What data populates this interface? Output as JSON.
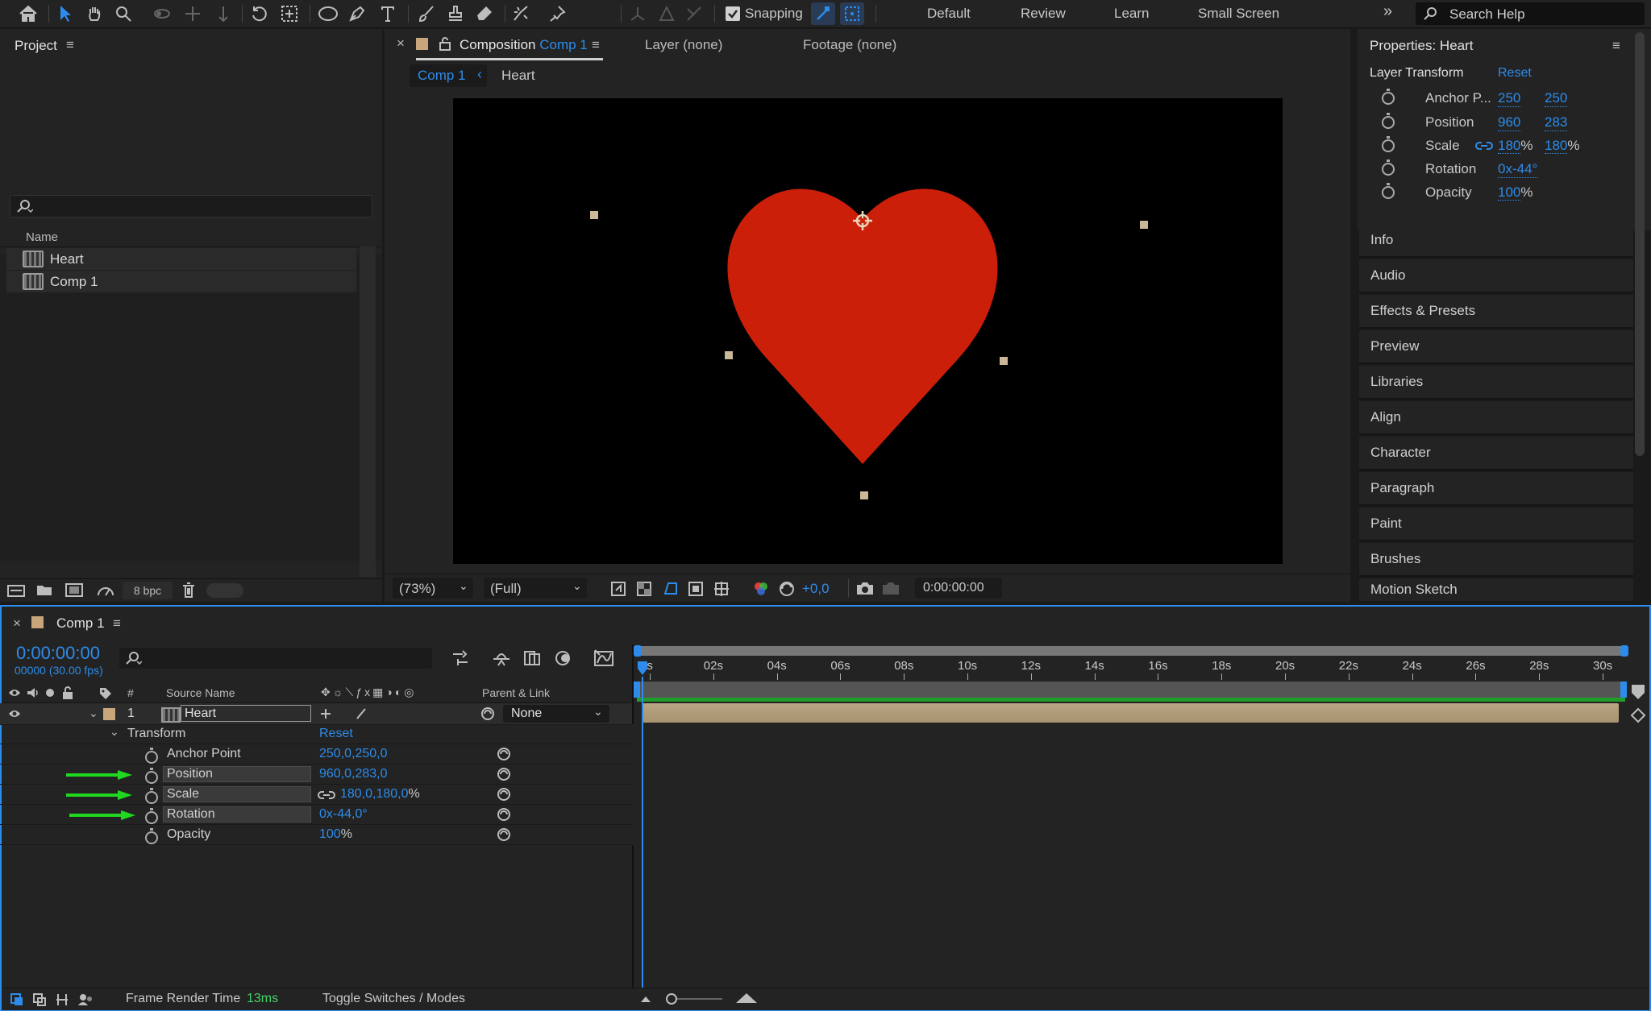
{
  "toolbar": {
    "snapping_label": "Snapping",
    "workspaces": [
      "Default",
      "Review",
      "Learn",
      "Small Screen"
    ],
    "search_placeholder": "Search Help"
  },
  "project": {
    "title": "Project",
    "column_name": "Name",
    "items": [
      {
        "label": "Heart"
      },
      {
        "label": "Comp 1"
      }
    ],
    "bit_depth": "8 bpc"
  },
  "composition": {
    "tab_prefix": "Composition",
    "tab_comp": "Comp 1",
    "layer_tab": "Layer (none)",
    "footage_tab": "Footage (none)",
    "breadcrumb_comp": "Comp 1",
    "breadcrumb_layer": "Heart",
    "zoom": "(73%)",
    "resolution": "(Full)",
    "exposure": "+0,0",
    "timecode": "0:00:00:00",
    "heart_color": "#cc1f0a"
  },
  "properties": {
    "title": "Properties: Heart",
    "section": "Layer Transform",
    "reset": "Reset",
    "rows": [
      {
        "label": "Anchor P...",
        "v1": "250",
        "v2": "250"
      },
      {
        "label": "Position",
        "v1": "960",
        "v2": "283"
      },
      {
        "label": "Scale",
        "v1": "180",
        "v2": "180"
      },
      {
        "label": "Rotation",
        "v1": "0x-44°"
      },
      {
        "label": "Opacity",
        "v1": "100"
      }
    ],
    "panels": [
      "Info",
      "Audio",
      "Effects & Presets",
      "Preview",
      "Libraries",
      "Align",
      "Character",
      "Paragraph",
      "Paint",
      "Brushes",
      "Motion Sketch"
    ]
  },
  "timeline": {
    "comp_name": "Comp 1",
    "timecode": "0:00:00:00",
    "fps": "00000 (30.00 fps)",
    "col_source_name": "Source Name",
    "col_parent": "Parent & Link",
    "col_number": "#",
    "layer_number": "1",
    "layer_name": "Heart",
    "parent_value": "None",
    "transform_label": "Transform",
    "transform_reset": "Reset",
    "props": [
      {
        "label": "Anchor Point",
        "value": "250,0,250,0"
      },
      {
        "label": "Position",
        "value": "960,0,283,0"
      },
      {
        "label": "Scale",
        "value": "180,0,180,0"
      },
      {
        "label": "Rotation",
        "value": "0x-44,0°"
      },
      {
        "label": "Opacity",
        "value": "100"
      }
    ],
    "ticks": [
      "0s",
      "02s",
      "04s",
      "06s",
      "08s",
      "10s",
      "12s",
      "14s",
      "16s",
      "18s",
      "20s",
      "22s",
      "24s",
      "26s",
      "28s",
      "30s"
    ],
    "frame_render_label": "Frame Render Time",
    "frame_render_value": "13ms",
    "toggle_label": "Toggle Switches / Modes",
    "arrow_color": "#1fd81f"
  }
}
